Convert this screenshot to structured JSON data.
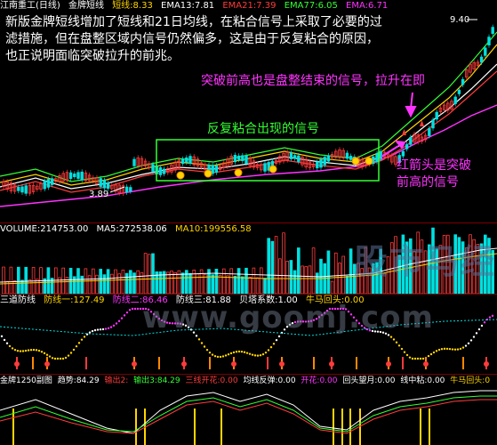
{
  "colors": {
    "bg": "#000000",
    "up": "#ff3b3b",
    "down": "#00e0e0",
    "ma_white": "#ffffff",
    "ma_yellow": "#ffd400",
    "ma_magenta": "#ff33ff",
    "ma_green": "#33ff33",
    "annotation_text": "#ff33ff",
    "explain_text": "#ffffff",
    "box": "#33ff33"
  },
  "price_panel": {
    "header": {
      "stock_name": "江南重工(日线)",
      "indicator": "金牌短线",
      "short_line": "短线:8.33",
      "ema13": "EMA13:7.81",
      "ema21": "EMA21:7.39",
      "ema77": "EMA77:6.05",
      "ema_last": "EMA:6.71"
    },
    "explain_lines": [
      "新版金牌短线增加了短线和21日均线，在粘合信号上采取了必要的过",
      "滤措施，但在盘整区域内信号仍然偏多，这是由于反复粘合的原因，",
      "也正说明面临突破拉升的前兆。"
    ],
    "annotations": {
      "break_high": "突破前高也是盘整结束的信号，拉升在即",
      "repeat_glue": "反复粘合出现的信号",
      "red_arrow_1": "红箭头是突破",
      "red_arrow_2": "前高的信号"
    },
    "price_high": "9.40",
    "price_low": "3.89"
  },
  "volume_panel": {
    "header": {
      "volume": "VOLUME:214753.00",
      "ma5": "MA5:272538.06",
      "ma10": "MA10:199556.58"
    },
    "watermark": "股市马经",
    "url_watermark": "www.goomj.com"
  },
  "sandao_panel": {
    "header": {
      "name": "三道防线",
      "line1": "防线一:127.49",
      "line2": "防线二:86.46",
      "line3": "防线三:81.88",
      "beita": "贝塔系数:1.00",
      "niuma": "牛马回头:0.00"
    }
  },
  "jinpan_panel": {
    "header": {
      "name": "金牌1250副图",
      "trend": "趋势:84.29",
      "out1": "输出2:",
      "out2": "输出3:84.29",
      "sanxian": "三线开花:0.00",
      "junxian": "均线反弹:0.00",
      "kaihua": "开花:0.00",
      "huitou": "回头望月:0.00",
      "xianzhong": "线中粘:0.00",
      "niuma": "牛马回头:0"
    }
  }
}
